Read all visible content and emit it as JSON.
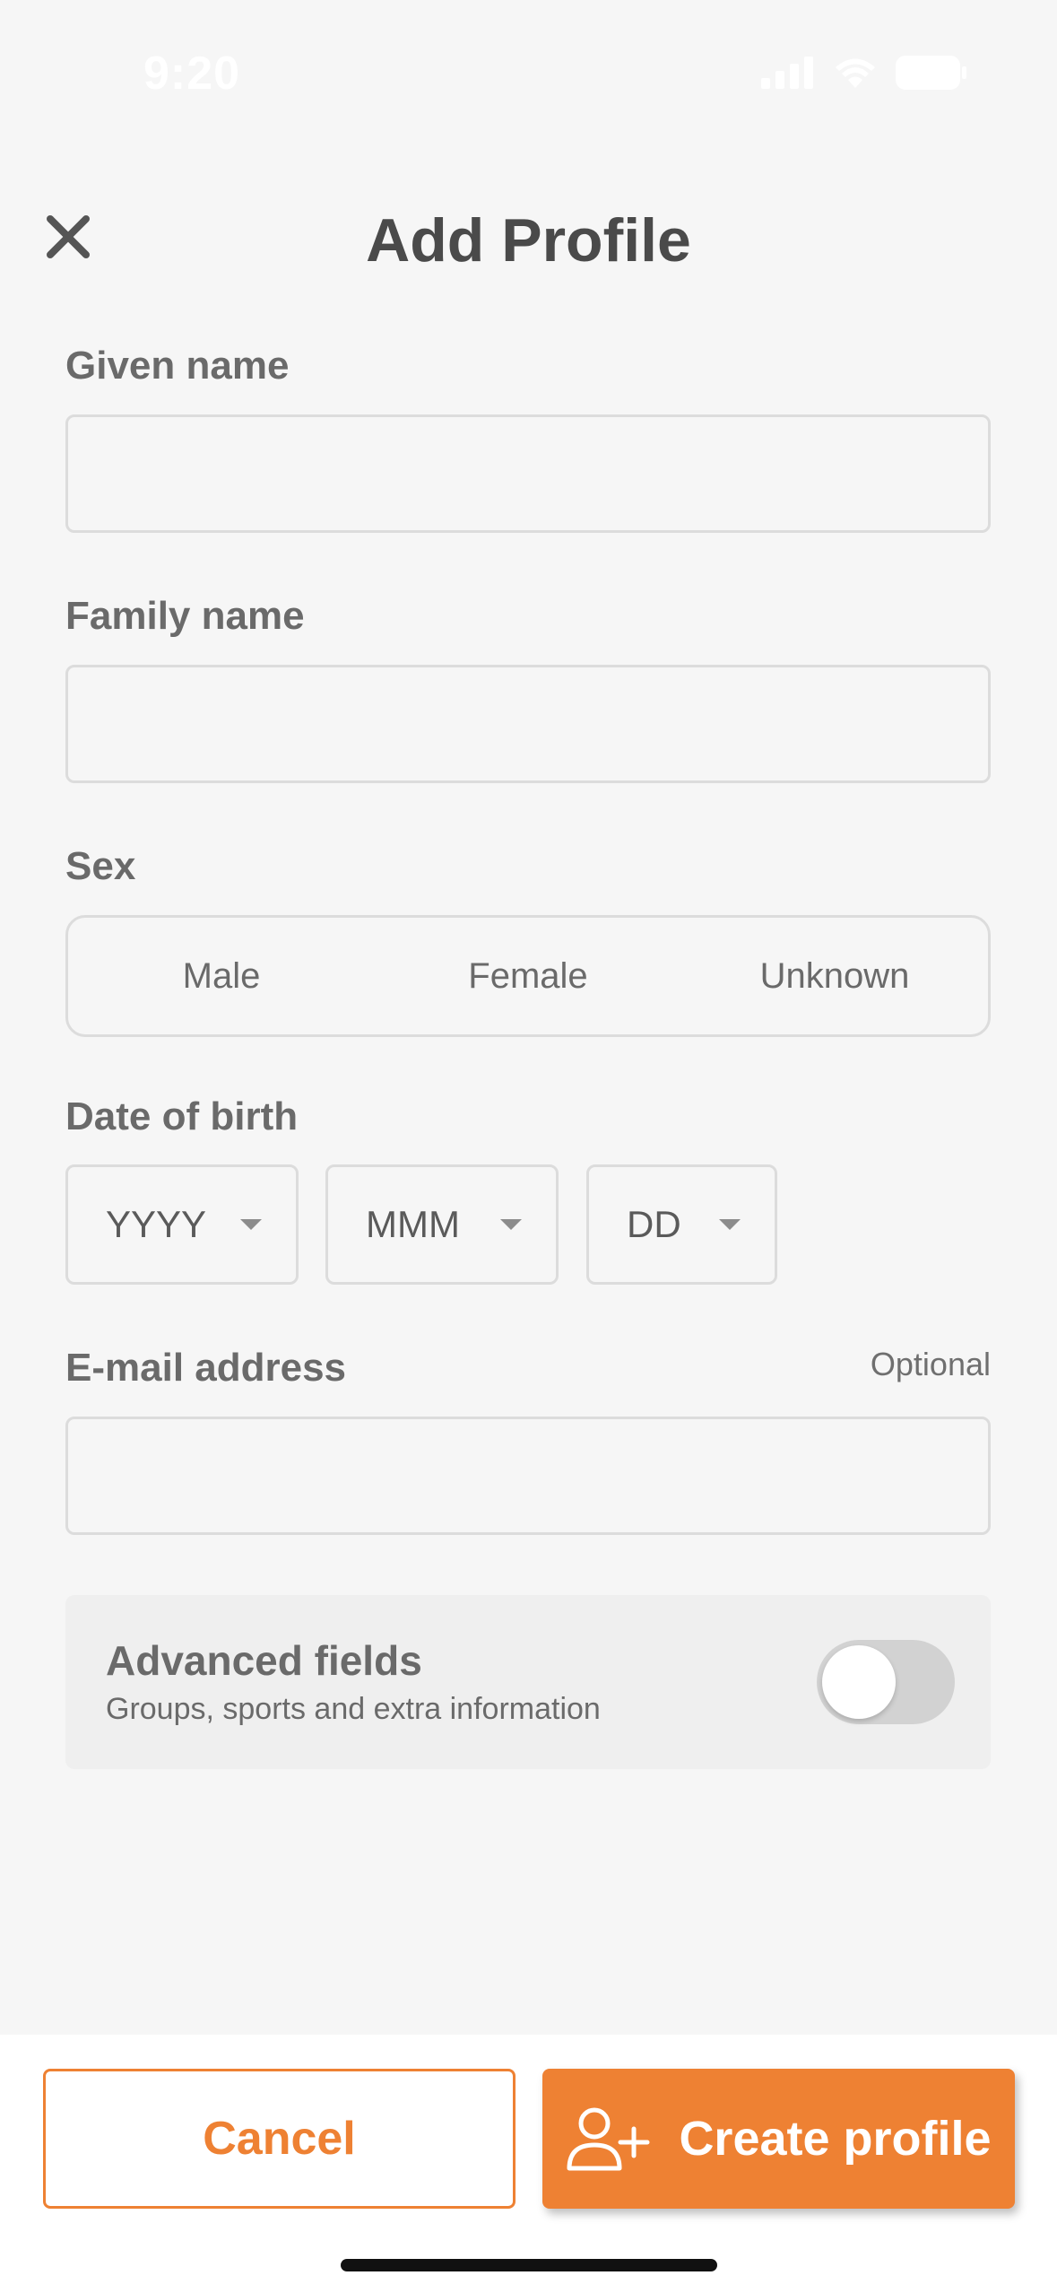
{
  "status_bar": {
    "time": "9:20",
    "icons": [
      "signal-icon",
      "wifi-icon",
      "battery-icon"
    ]
  },
  "header": {
    "title": "Add Profile",
    "close_icon": "close-icon"
  },
  "form": {
    "given_name": {
      "label": "Given name",
      "value": "",
      "placeholder": ""
    },
    "family_name": {
      "label": "Family name",
      "value": "",
      "placeholder": ""
    },
    "sex": {
      "label": "Sex",
      "options": [
        "Male",
        "Female",
        "Unknown"
      ]
    },
    "date_of_birth": {
      "label": "Date of birth",
      "year": "YYYY",
      "month": "MMM",
      "day": "DD"
    },
    "email": {
      "label": "E-mail address",
      "optional_label": "Optional",
      "value": "",
      "placeholder": ""
    },
    "advanced": {
      "title": "Advanced fields",
      "subtitle": "Groups, sports and extra information",
      "enabled": false
    }
  },
  "actions": {
    "cancel_label": "Cancel",
    "create_label": "Create profile",
    "create_icon": "add-user-icon"
  },
  "colors": {
    "accent": "#ee8133",
    "background": "#f6f6f6",
    "text": "#6a6a6a"
  }
}
